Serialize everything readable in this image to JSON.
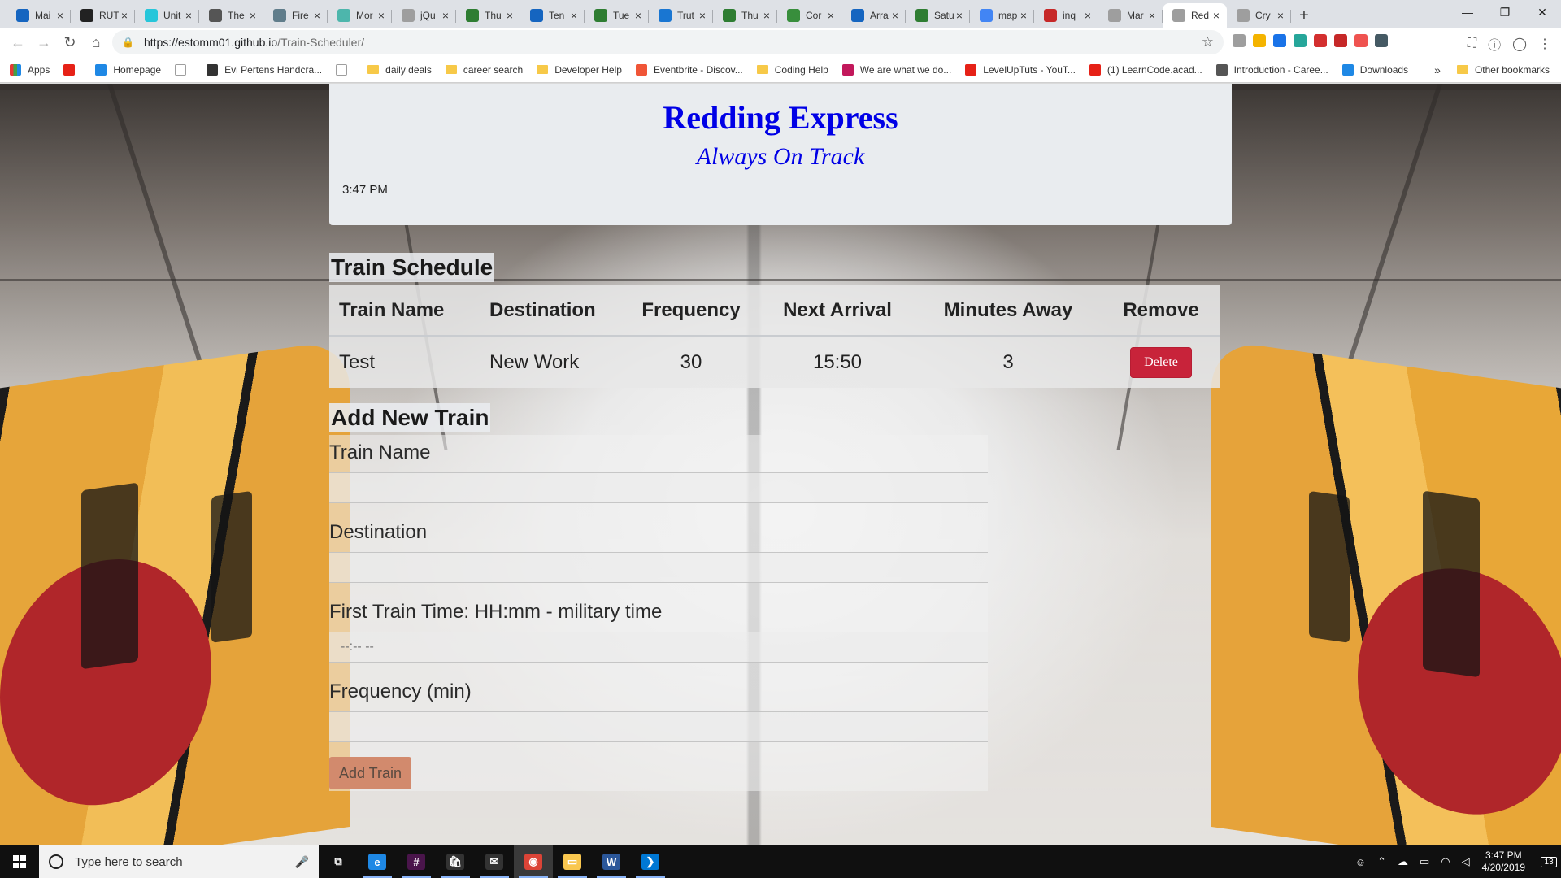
{
  "browser": {
    "tabs": [
      {
        "title": "Mai",
        "color": "#1565c0",
        "icon": "outlook-icon"
      },
      {
        "title": "RUT",
        "color": "#222222",
        "icon": "github-icon"
      },
      {
        "title": "Unit",
        "color": "#26c6da",
        "icon": "diamond-icon"
      },
      {
        "title": "The",
        "color": "#555555",
        "icon": "globe-icon"
      },
      {
        "title": "Fire",
        "color": "#607d8b",
        "icon": "code-icon"
      },
      {
        "title": "Mor",
        "color": "#4db6ac",
        "icon": "clock-icon"
      },
      {
        "title": "jQu",
        "color": "#9e9e9e",
        "icon": "page-icon"
      },
      {
        "title": "Thu",
        "color": "#2e7d32",
        "icon": "recycle-icon"
      },
      {
        "title": "Ten",
        "color": "#1565c0",
        "icon": "mortarboard-icon"
      },
      {
        "title": "Tue",
        "color": "#2e7d32",
        "icon": "recycle-icon"
      },
      {
        "title": "Trut",
        "color": "#1976d2",
        "icon": "wordpress-icon"
      },
      {
        "title": "Thu",
        "color": "#2e7d32",
        "icon": "recycle-icon"
      },
      {
        "title": "Cor",
        "color": "#388e3c",
        "icon": "node-icon"
      },
      {
        "title": "Arra",
        "color": "#1565c0",
        "icon": "mortarboard-icon"
      },
      {
        "title": "Satu",
        "color": "#2e7d32",
        "icon": "recycle-icon"
      },
      {
        "title": "map",
        "color": "#4285f4",
        "icon": "google-icon"
      },
      {
        "title": "inq",
        "color": "#c62828",
        "icon": "n-icon"
      },
      {
        "title": "Mar",
        "color": "#9e9e9e",
        "icon": "page-icon"
      },
      {
        "title": "Red",
        "color": "#9e9e9e",
        "icon": "page-icon",
        "active": true
      },
      {
        "title": "Cry",
        "color": "#9e9e9e",
        "icon": "page-icon"
      }
    ],
    "url_host": "https://estomm01.github.io",
    "url_path": "/Train-Scheduler/",
    "bookmarks": [
      {
        "label": "Apps",
        "type": "apps",
        "color": "#e53935"
      },
      {
        "label": "",
        "type": "youtube",
        "color": "#e62117"
      },
      {
        "label": "Homepage",
        "type": "icon",
        "color": "#1e88e5"
      },
      {
        "label": "",
        "type": "page",
        "color": "#9e9e9e"
      },
      {
        "label": "Evi Pertens Handcra...",
        "type": "icon",
        "color": "#333333"
      },
      {
        "label": "",
        "type": "page",
        "color": "#9e9e9e"
      },
      {
        "label": "daily deals",
        "type": "folder",
        "color": "#f7c948"
      },
      {
        "label": "career search",
        "type": "folder",
        "color": "#f7c948"
      },
      {
        "label": "Developer Help",
        "type": "folder",
        "color": "#f7c948"
      },
      {
        "label": "Eventbrite - Discov...",
        "type": "icon",
        "color": "#f05537"
      },
      {
        "label": "Coding Help",
        "type": "folder",
        "color": "#f7c948"
      },
      {
        "label": "We are what we do...",
        "type": "icon",
        "color": "#c2185b"
      },
      {
        "label": "LevelUpTuts - YouT...",
        "type": "youtube",
        "color": "#e62117"
      },
      {
        "label": "(1) LearnCode.acad...",
        "type": "youtube",
        "color": "#e62117"
      },
      {
        "label": "Introduction - Caree...",
        "type": "icon",
        "color": "#555555"
      },
      {
        "label": "Downloads",
        "type": "icon",
        "color": "#1e88e5"
      }
    ],
    "bookmarks_more": "»",
    "other_bookmarks": "Other bookmarks"
  },
  "header": {
    "title": "Redding Express",
    "tagline": "Always On Track",
    "current_time": "3:47 PM"
  },
  "schedule": {
    "section_title": "Train Schedule",
    "columns": [
      "Train Name",
      "Destination",
      "Frequency",
      "Next Arrival",
      "Minutes Away",
      "Remove"
    ],
    "rows": [
      {
        "name": "Test",
        "destination": "New Work",
        "frequency": "30",
        "next_arrival": "15:50",
        "minutes_away": "3",
        "action": "Delete"
      }
    ]
  },
  "form": {
    "section_title": "Add New Train",
    "name_label": "Train Name",
    "destination_label": "Destination",
    "first_time_label": "First Train Time: HH:mm - military time",
    "first_time_placeholder": "--:-- --",
    "frequency_label": "Frequency (min)",
    "submit_label": "Add Train"
  },
  "taskbar": {
    "search_placeholder": "Type here to search",
    "apps": [
      {
        "name": "task-view-icon",
        "color": "transparent",
        "glyph": "⧉"
      },
      {
        "name": "edge-icon",
        "color": "#1e88e5",
        "glyph": "e"
      },
      {
        "name": "slack-icon",
        "color": "#4a154b",
        "glyph": "#"
      },
      {
        "name": "store-icon",
        "color": "#333333",
        "glyph": "🛍"
      },
      {
        "name": "mail-icon",
        "color": "#333333",
        "glyph": "✉"
      },
      {
        "name": "chrome-icon",
        "color": "#db4437",
        "glyph": "◉"
      },
      {
        "name": "file-explorer-icon",
        "color": "#f9c74f",
        "glyph": "▭"
      },
      {
        "name": "word-icon",
        "color": "#2b579a",
        "glyph": "W"
      },
      {
        "name": "vscode-icon",
        "color": "#0078d4",
        "glyph": "❯"
      }
    ],
    "time": "3:47 PM",
    "date": "4/20/2019",
    "notification_count": "13"
  }
}
